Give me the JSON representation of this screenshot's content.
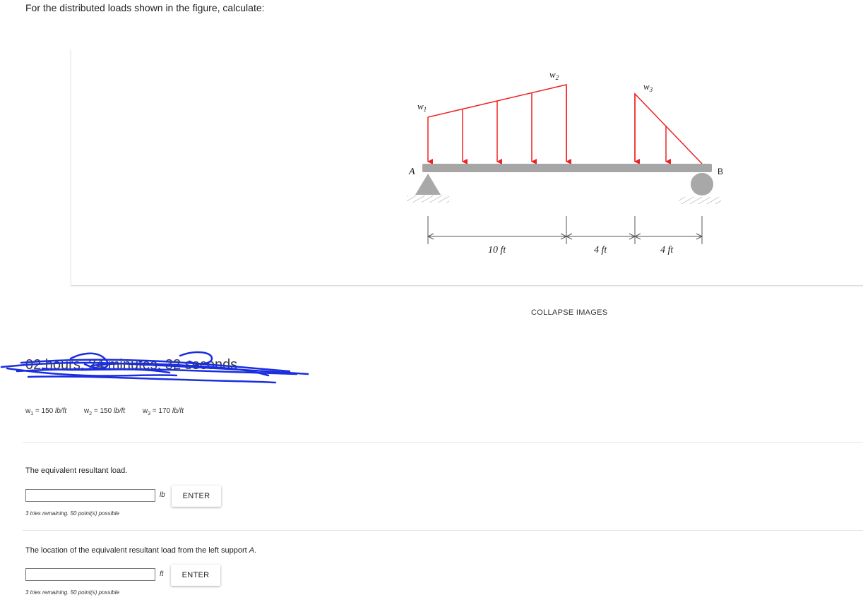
{
  "prompt": "For the distributed loads shown in the figure, calculate:",
  "figure": {
    "labels": {
      "w1": "w1",
      "w2": "w2",
      "w3": "w3",
      "support_a": "A",
      "support_b": "B",
      "dim1": "10 ft",
      "dim2": "4 ft",
      "dim3": "4 ft"
    },
    "colors": {
      "load": "#ee2222",
      "beam": "#a6a6a6",
      "support": "#a8a8a8",
      "dim": "#555555"
    }
  },
  "collapse_label": "COLLAPSE IMAGES",
  "timer": {
    "text": "02 hours, 24 minutes, 32 seconds",
    "scribble_color": "#1a2ee0"
  },
  "variables": [
    {
      "name": "w",
      "sub": "1",
      "value": "= 150",
      "unit": "lb/ft"
    },
    {
      "name": "w",
      "sub": "2",
      "value": "= 150",
      "unit": "lb/ft"
    },
    {
      "name": "w",
      "sub": "3",
      "value": "= 170",
      "unit": "lb/ft"
    }
  ],
  "questions": [
    {
      "text": "The equivalent resultant load.",
      "input_value": "",
      "unit": "lb",
      "button": "ENTER",
      "tries": "3 tries remaining. 50 point(s) possible"
    },
    {
      "text_main": "The location of the equivalent resultant load from the left support ",
      "text_italic": "A",
      "text_end": ".",
      "input_value": "",
      "unit": "ft",
      "button": "ENTER",
      "tries": "3 tries remaining. 50 point(s) possible"
    }
  ]
}
